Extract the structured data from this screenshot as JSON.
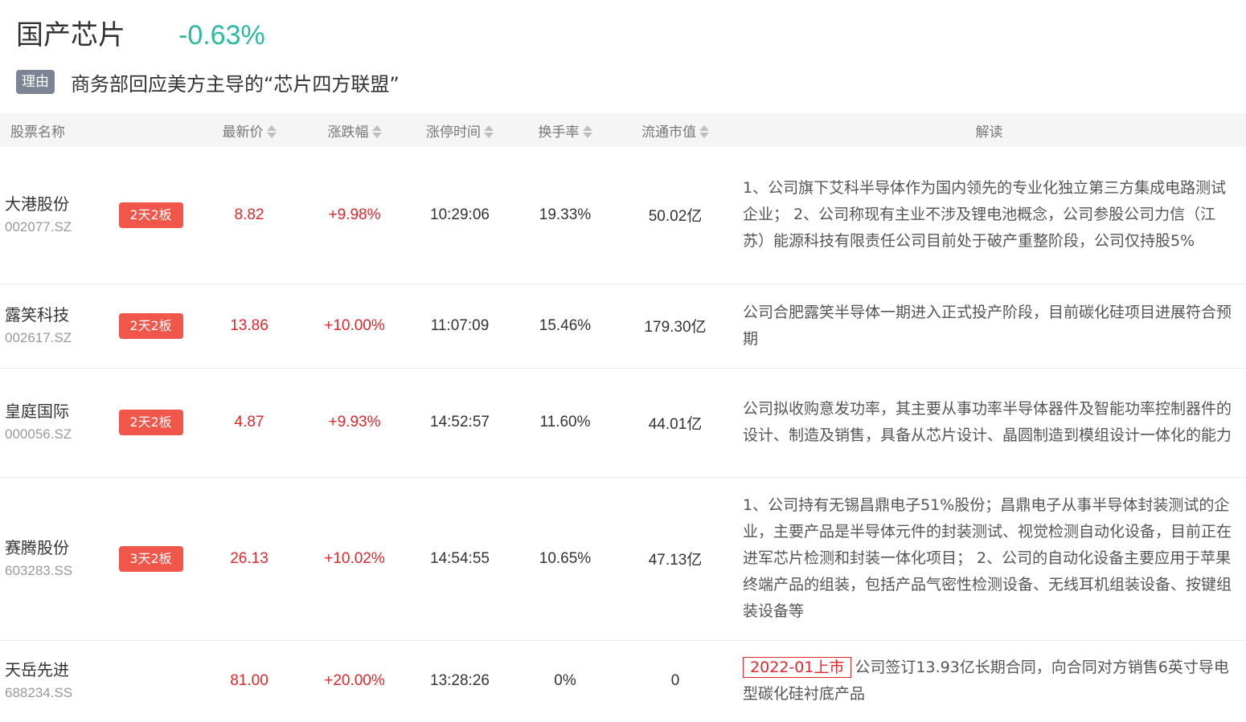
{
  "header": {
    "title": "国产芯片",
    "change": "-0.63%",
    "reason_badge": "理由",
    "reason_text": "商务部回应美方主导的“芯片四方联盟”"
  },
  "columns": {
    "name": "股票名称",
    "price": "最新价",
    "change": "涨跌幅",
    "limit_time": "涨停时间",
    "turnover": "换手率",
    "market_cap": "流通市值",
    "reading": "解读"
  },
  "rows": [
    {
      "name": "大港股份",
      "code": "002077.SZ",
      "tag": "2天2板",
      "price": "8.82",
      "change": "+9.98%",
      "limit_time": "10:29:06",
      "turnover": "19.33%",
      "market_cap": "50.02亿",
      "ipo_tag": "",
      "reading": "1、公司旗下艾科半导体作为国内领先的专业化独立第三方集成电路测试企业； 2、公司称现有主业不涉及锂电池概念，公司参股公司力信（江苏）能源科技有限责任公司目前处于破产重整阶段，公司仅持股5%"
    },
    {
      "name": "露笑科技",
      "code": "002617.SZ",
      "tag": "2天2板",
      "price": "13.86",
      "change": "+10.00%",
      "limit_time": "11:07:09",
      "turnover": "15.46%",
      "market_cap": "179.30亿",
      "ipo_tag": "",
      "reading": "公司合肥露笑半导体一期进入正式投产阶段，目前碳化硅项目进展符合预期"
    },
    {
      "name": "皇庭国际",
      "code": "000056.SZ",
      "tag": "2天2板",
      "price": "4.87",
      "change": "+9.93%",
      "limit_time": "14:52:57",
      "turnover": "11.60%",
      "market_cap": "44.01亿",
      "ipo_tag": "",
      "reading": "公司拟收购意发功率，其主要从事功率半导体器件及智能功率控制器件的设计、制造及销售，具备从芯片设计、晶圆制造到模组设计一体化的能力"
    },
    {
      "name": "赛腾股份",
      "code": "603283.SS",
      "tag": "3天2板",
      "price": "26.13",
      "change": "+10.02%",
      "limit_time": "14:54:55",
      "turnover": "10.65%",
      "market_cap": "47.13亿",
      "ipo_tag": "",
      "reading": "1、公司持有无锡昌鼎电子51%股份；昌鼎电子从事半导体封装测试的企业，主要产品是半导体元件的封装测试、视觉检测自动化设备，目前正在进军芯片检测和封装一体化项目； 2、公司的自动化设备主要应用于苹果终端产品的组装，包括产品气密性检测设备、无线耳机组装设备、按键组装设备等"
    },
    {
      "name": "天岳先进",
      "code": "688234.SS",
      "tag": "",
      "price": "81.00",
      "change": "+20.00%",
      "limit_time": "13:28:26",
      "turnover": "0%",
      "market_cap": "0",
      "ipo_tag": "2022-01上市",
      "reading": "公司签订13.93亿长期合同，向合同对方销售6英寸导电型碳化硅衬底产品"
    }
  ]
}
